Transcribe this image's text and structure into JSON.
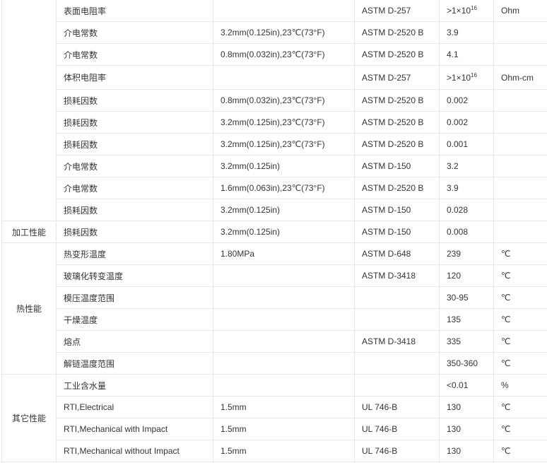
{
  "rows": [
    {
      "category": "",
      "prop": "表面电阻率",
      "cond": "",
      "method": "ASTM D-257",
      "value": "",
      "unit": "Ohm",
      "sci": {
        "prefix": ">1×10",
        "exp": "16"
      }
    },
    {
      "category": "",
      "prop": "介电常数",
      "cond": "3.2mm(0.125in),23℃(73°F)",
      "method": "ASTM D-2520 B",
      "value": "3.9",
      "unit": ""
    },
    {
      "category": "",
      "prop": "介电常数",
      "cond": "0.8mm(0.032in),23℃(73°F)",
      "method": "ASTM D-2520 B",
      "value": "4.1",
      "unit": ""
    },
    {
      "category": "",
      "prop": "体积电阻率",
      "cond": "",
      "method": "ASTM D-257",
      "value": "",
      "unit": "Ohm-cm",
      "sci": {
        "prefix": ">1×10",
        "exp": "16"
      }
    },
    {
      "category": "",
      "prop": "损耗因数",
      "cond": "0.8mm(0.032in),23℃(73°F)",
      "method": "ASTM D-2520 B",
      "value": "0.002",
      "unit": ""
    },
    {
      "category": "",
      "prop": "损耗因数",
      "cond": "3.2mm(0.125in),23℃(73°F)",
      "method": "ASTM D-2520 B",
      "value": "0.002",
      "unit": ""
    },
    {
      "category": "",
      "prop": "损耗因数",
      "cond": "3.2mm(0.125in),23℃(73°F)",
      "method": "ASTM D-2520 B",
      "value": "0.001",
      "unit": ""
    },
    {
      "category": "",
      "prop": "介电常数",
      "cond": "3.2mm(0.125in)",
      "method": "ASTM D-150",
      "value": "3.2",
      "unit": ""
    },
    {
      "category": "",
      "prop": "介电常数",
      "cond": "1.6mm(0.063in),23℃(73°F)",
      "method": "ASTM D-2520 B",
      "value": "3.9",
      "unit": ""
    },
    {
      "category": "",
      "prop": "损耗因数",
      "cond": "3.2mm(0.125in)",
      "method": "ASTM D-150",
      "value": "0.028",
      "unit": ""
    },
    {
      "category": "加工性能",
      "prop": "损耗因数",
      "cond": "3.2mm(0.125in)",
      "method": "ASTM D-150",
      "value": "0.008",
      "unit": ""
    },
    {
      "category": "热性能",
      "prop": "热变形温度",
      "cond": "1.80MPa",
      "method": "ASTM D-648",
      "value": "239",
      "unit": "℃"
    },
    {
      "category": "",
      "prop": "玻璃化转变温度",
      "cond": "",
      "method": "ASTM D-3418",
      "value": "120",
      "unit": "℃"
    },
    {
      "category": "",
      "prop": "模压温度范围",
      "cond": "",
      "method": "",
      "value": "30-95",
      "unit": "℃"
    },
    {
      "category": "",
      "prop": "干燥温度",
      "cond": "",
      "method": "",
      "value": "135",
      "unit": "℃"
    },
    {
      "category": "",
      "prop": "熔点",
      "cond": "",
      "method": "ASTM D-3418",
      "value": "335",
      "unit": "℃"
    },
    {
      "category": "",
      "prop": "解链温度范围",
      "cond": "",
      "method": "",
      "value": "350-360",
      "unit": "℃"
    },
    {
      "category": "其它性能",
      "prop": "工业含水量",
      "cond": "",
      "method": "",
      "value": "<0.01",
      "unit": "%"
    },
    {
      "category": "",
      "prop": "RTI,Electrical",
      "cond": "1.5mm",
      "method": "UL 746-B",
      "value": "130",
      "unit": "℃"
    },
    {
      "category": "",
      "prop": "RTI,Mechanical with Impact",
      "cond": "1.5mm",
      "method": "UL 746-B",
      "value": "130",
      "unit": "℃"
    },
    {
      "category": "",
      "prop": "RTI,Mechanical without Impact",
      "cond": "1.5mm",
      "method": "UL 746-B",
      "value": "130",
      "unit": "℃"
    }
  ]
}
